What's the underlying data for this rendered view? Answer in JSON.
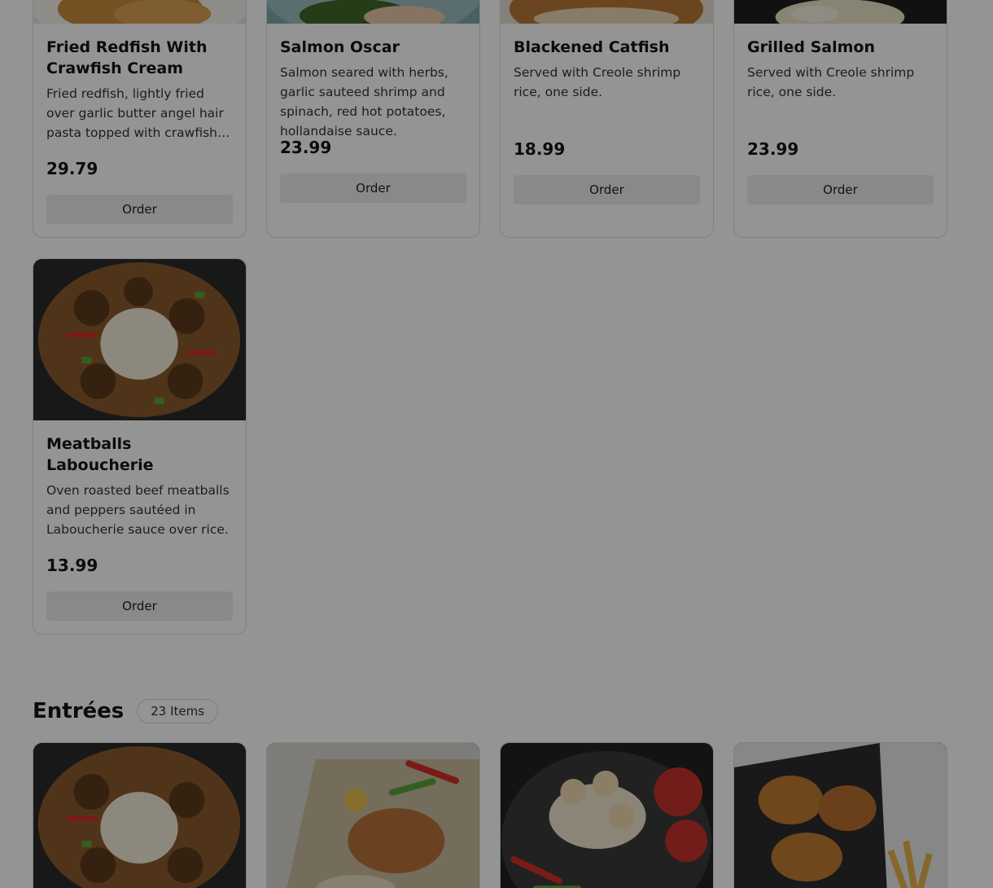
{
  "top_row": [
    {
      "title": "Fried Redfish With Crawfish Cream",
      "description": "Fried redfish, lightly fried over garlic butter angel hair pasta topped with crawfish cream sauce.",
      "price": "29.79",
      "order_label": "Order",
      "image": "fried-redfish-photo"
    },
    {
      "title": "Salmon Oscar",
      "description": "Salmon seared with herbs, garlic sauteed shrimp and spinach, red hot potatoes, hollandaise sauce.",
      "price": "23.99",
      "order_label": "Order",
      "image": "salmon-oscar-photo"
    },
    {
      "title": "Blackened Catfish",
      "description": "Served with Creole shrimp rice, one side.",
      "price": "18.99",
      "order_label": "Order",
      "image": "blackened-catfish-photo"
    },
    {
      "title": "Grilled Salmon",
      "description": "Served with Creole shrimp rice, one side.",
      "price": "23.99",
      "order_label": "Order",
      "image": "grilled-salmon-photo"
    }
  ],
  "mid_row": [
    {
      "title": "Meatballs Laboucherie",
      "description": "Oven roasted beef meatballs and peppers sautéed in Laboucherie sauce over rice.",
      "price": "13.99",
      "order_label": "Order",
      "image": "meatballs-photo"
    }
  ],
  "section": {
    "title": "Entrées",
    "count": "23 Items"
  },
  "colors": {
    "overlay": "#000000",
    "button_bg": "#ececec",
    "card_border": "#dcdcdc"
  }
}
